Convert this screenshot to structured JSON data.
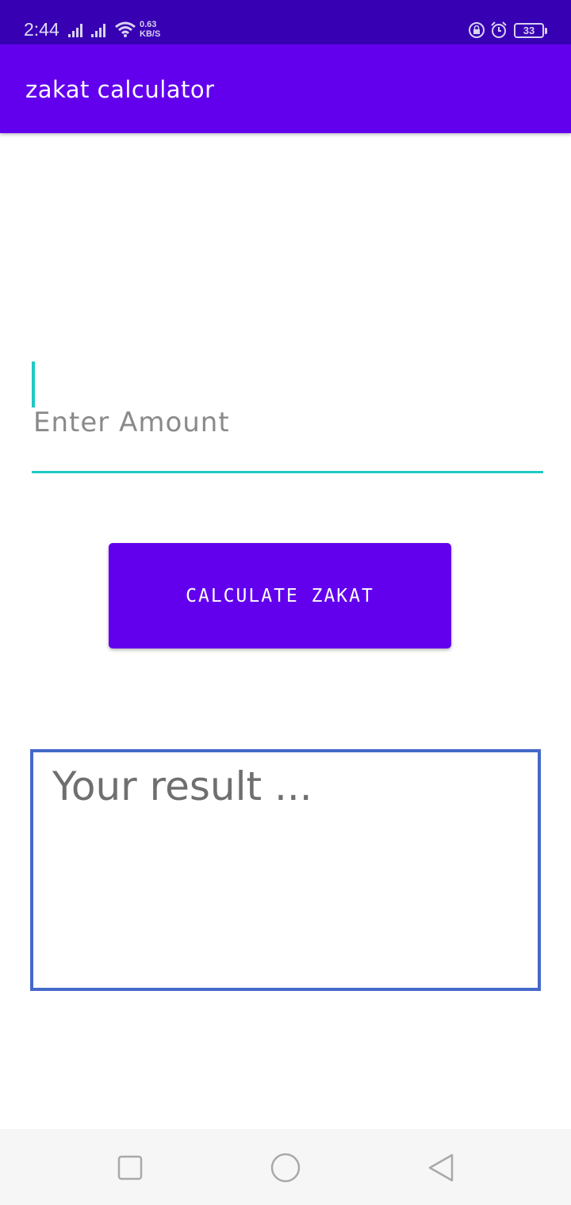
{
  "status_bar": {
    "time": "2:44",
    "net_speed_value": "0.63",
    "net_speed_unit": "KB/S",
    "battery": "33"
  },
  "app_bar": {
    "title": "zakat calculator"
  },
  "amount_input": {
    "value": "",
    "placeholder": "Enter Amount"
  },
  "calculate_button": {
    "label": "CALCULATE ZAKAT"
  },
  "result": {
    "text": "Your result ..."
  },
  "colors": {
    "status_bar": "#3700b3",
    "primary": "#6200ee",
    "accent": "#1fc9c4",
    "result_border": "#4469c9"
  },
  "icons": [
    "signal-icon",
    "wifi-icon",
    "lock-rotation-icon",
    "alarm-icon",
    "battery-icon",
    "recent-apps-icon",
    "home-icon",
    "back-icon"
  ]
}
